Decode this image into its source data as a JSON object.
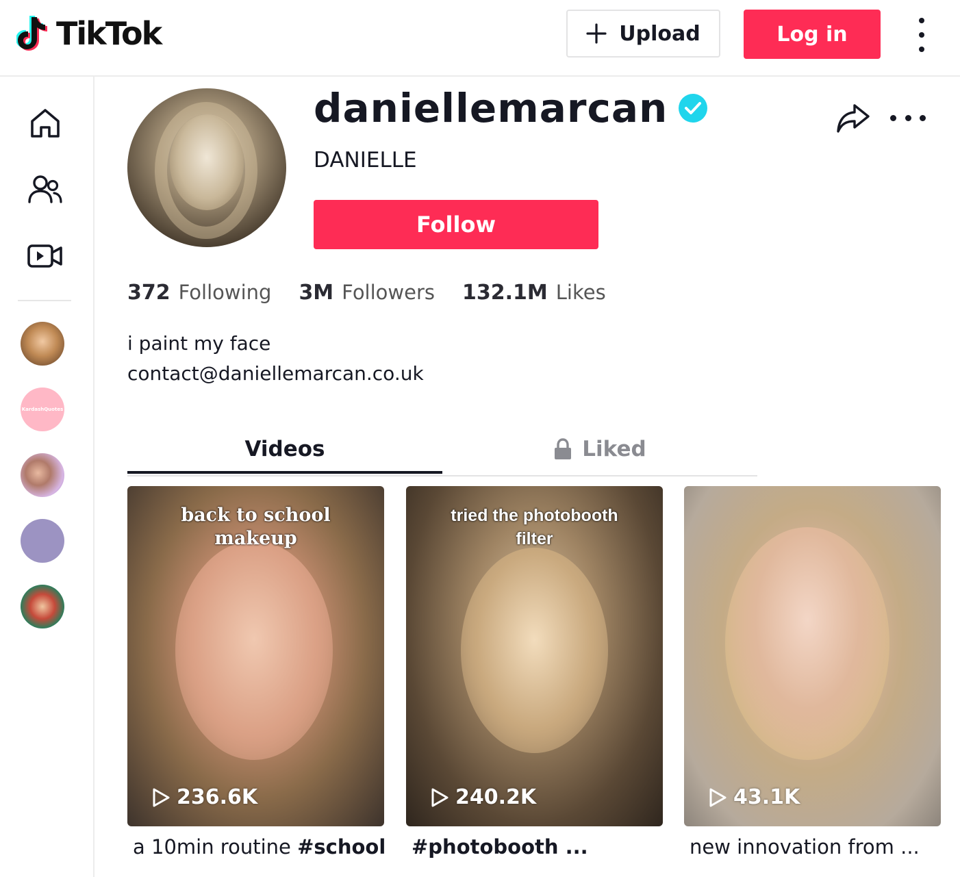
{
  "header": {
    "logo_text": "TikTok",
    "upload_label": "Upload",
    "login_label": "Log in"
  },
  "sidebar": {
    "nav": [
      {
        "icon": "home-icon"
      },
      {
        "icon": "following-icon"
      },
      {
        "icon": "live-icon"
      }
    ],
    "suggested_accounts": [
      {
        "icon": "avatar",
        "color": "#c9a27a"
      },
      {
        "icon": "avatar",
        "label": "KardashQuotes",
        "color": "#ffb8c6"
      },
      {
        "icon": "avatar",
        "color": "#c7a0c6"
      },
      {
        "icon": "avatar",
        "color": "#9c93c2"
      },
      {
        "icon": "avatar",
        "color": "#c54a3a"
      }
    ]
  },
  "profile": {
    "username": "daniellemarcan",
    "display_name": "DANIELLE",
    "follow_label": "Follow",
    "stats": {
      "following_count": "372",
      "following_label": "Following",
      "followers_count": "3M",
      "followers_label": "Followers",
      "likes_count": "132.1M",
      "likes_label": "Likes"
    },
    "bio_line1": "i paint my face",
    "bio_line2": "contact@daniellemarcan.co.uk"
  },
  "tabs": {
    "videos_label": "Videos",
    "liked_label": "Liked"
  },
  "videos": [
    {
      "caption": "back to school makeup",
      "views": "236.6K",
      "desc_text": "a 10min routine ",
      "desc_tag": "#school..."
    },
    {
      "caption": "tried the photobooth filter",
      "views": "240.2K",
      "desc_text": "",
      "desc_tag": "#photobooth ..."
    },
    {
      "caption": "",
      "views": "43.1K",
      "desc_text": "new innovation from ...",
      "desc_tag": ""
    }
  ],
  "colors": {
    "accent": "#fe2c55",
    "verified": "#20d5ec",
    "text": "#161823"
  }
}
